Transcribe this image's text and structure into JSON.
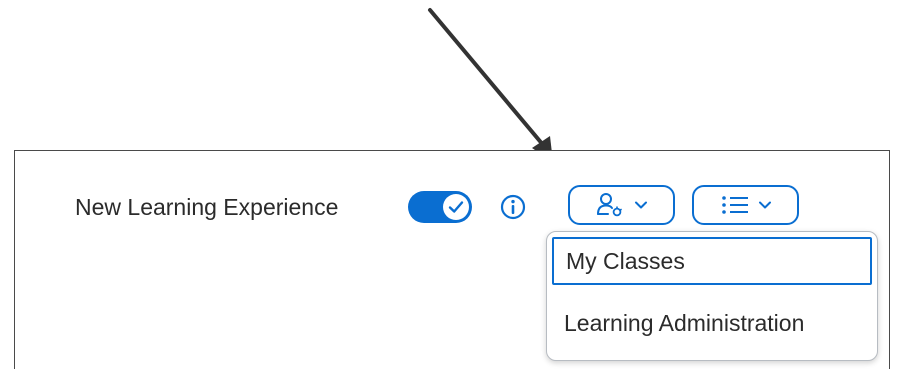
{
  "toolbar": {
    "nle_label": "New Learning Experience",
    "toggle_state": "on",
    "info_icon": "info-icon",
    "role_icon": "user-role-icon",
    "list_icon": "list-icon"
  },
  "menu": {
    "items": [
      {
        "label": "My Classes",
        "focused": true
      },
      {
        "label": "Learning Administration",
        "focused": false
      }
    ]
  },
  "colors": {
    "accent": "#0a6ed1",
    "text": "#2b2b2b",
    "arrow": "#333333"
  }
}
